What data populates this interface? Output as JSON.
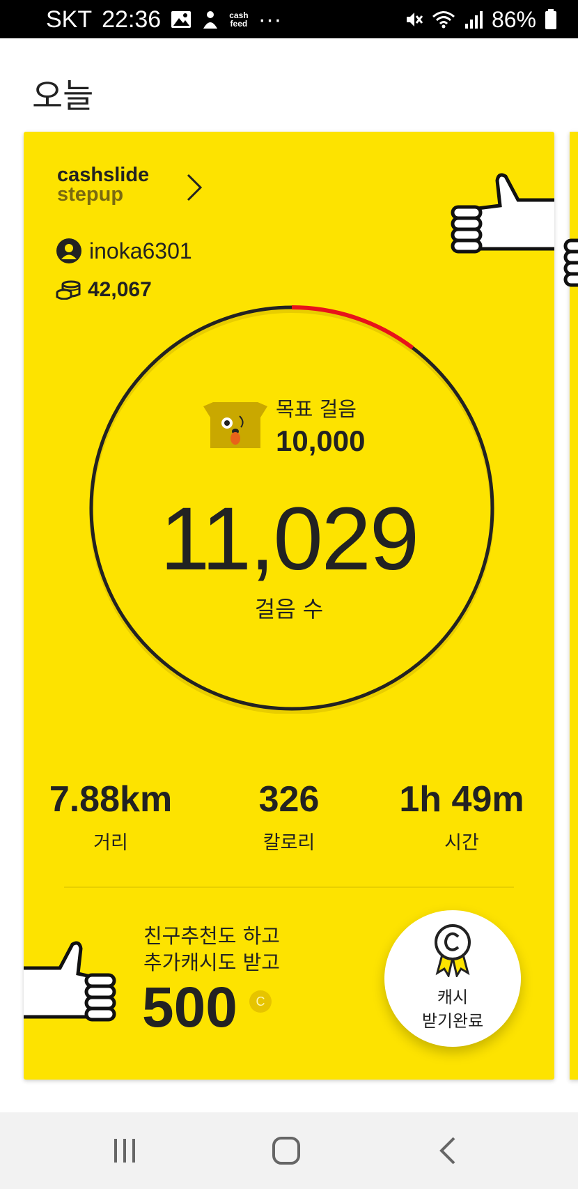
{
  "status_bar": {
    "carrier": "SKT",
    "time": "22:36",
    "cashfeed_line1": "cash",
    "cashfeed_line2": "feed",
    "more": "···",
    "battery": "86%"
  },
  "page": {
    "title": "오늘"
  },
  "card": {
    "brand_line1": "cashslide",
    "brand_line2": "stepup",
    "username": "inoka6301",
    "coins": "42,067",
    "goal_label": "목표 걸음",
    "goal_value": "10,000",
    "steps": "11,029",
    "steps_label": "걸음 수",
    "goal_progress_fraction": 1.1029,
    "stats": [
      {
        "value": "7.88km",
        "label": "거리"
      },
      {
        "value": "326",
        "label": "칼로리"
      },
      {
        "value": "1h 49m",
        "label": "시간"
      }
    ],
    "promo_line1": "친구추천도 하고",
    "promo_line2": "추가캐시도 받고",
    "promo_amount": "500",
    "promo_coin_symbol": "C",
    "claim_line1": "캐시",
    "claim_line2": "받기완료"
  },
  "colors": {
    "card_bg": "#fde300",
    "ring": "#222222",
    "ring_overflow": "#e8121a",
    "text": "#222222"
  },
  "icons": [
    "gallery-icon",
    "cashfeed-icon",
    "mute-icon",
    "wifi-icon",
    "signal-icon",
    "battery-icon",
    "chevron-right-icon",
    "user-icon",
    "coins-icon",
    "dog-icon",
    "thumbs-up-icon",
    "medal-icon",
    "recent-apps-icon",
    "home-icon",
    "back-icon"
  ]
}
